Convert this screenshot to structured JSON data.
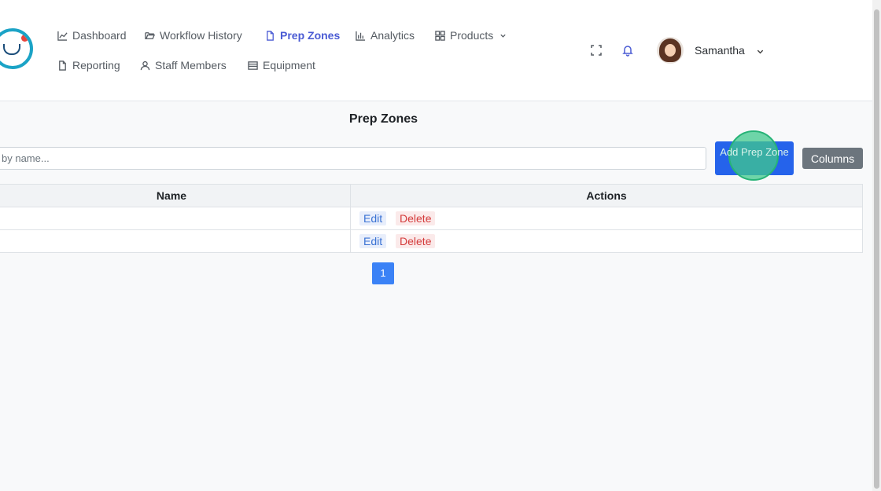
{
  "nav": {
    "items": [
      {
        "label": "Dashboard",
        "icon": "chart-line-icon"
      },
      {
        "label": "Workflow History",
        "icon": "folder-open-icon"
      },
      {
        "label": "Prep Zones",
        "icon": "file-icon",
        "active": true
      },
      {
        "label": "Analytics",
        "icon": "bar-chart-icon"
      },
      {
        "label": "Products",
        "icon": "grid-icon",
        "dropdown": true
      },
      {
        "label": "Reporting",
        "icon": "file-icon"
      },
      {
        "label": "Staff Members",
        "icon": "user-icon"
      },
      {
        "label": "Equipment",
        "icon": "list-icon"
      }
    ]
  },
  "user": {
    "name": "Samantha"
  },
  "page": {
    "title": "Prep Zones"
  },
  "search": {
    "placeholder": "by name..."
  },
  "buttons": {
    "add": "Add Prep Zone",
    "columns": "Columns"
  },
  "table": {
    "headers": [
      "Name",
      "Actions"
    ],
    "rows": [
      {
        "name": "",
        "edit": "Edit",
        "delete": "Delete"
      },
      {
        "name": "",
        "edit": "Edit",
        "delete": "Delete"
      }
    ]
  },
  "pagination": {
    "current": "1"
  },
  "colors": {
    "primary": "#2563eb",
    "active_nav": "#4a5bd4",
    "secondary": "#6c757d",
    "highlight": "#27b377"
  }
}
